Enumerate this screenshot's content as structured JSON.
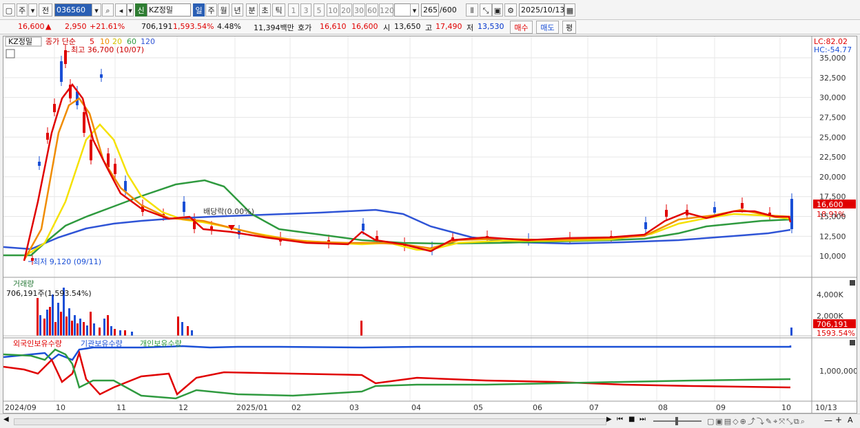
{
  "toolbar": {
    "market": "주",
    "period_prefix": "전",
    "code": "036560",
    "stock_name": "KZ정밀",
    "new_badge": "신",
    "periods": [
      "일",
      "주",
      "월",
      "년",
      "분",
      "초",
      "틱"
    ],
    "minute_options": [
      "1",
      "3",
      "5",
      "10",
      "20",
      "30",
      "60",
      "120"
    ],
    "count": "265",
    "count_total": "/600",
    "date": "2025/10/13"
  },
  "quote": {
    "price": "16,600",
    "change": "2,950",
    "change_pct": "+21.61%",
    "volume": "706,191",
    "volume_pct": "1,593.54%",
    "turnover": "4.48%",
    "amount": "11,394백만",
    "bid_label": "호가",
    "bid1": "16,610",
    "bid2": "16,600",
    "open_label": "시",
    "open": "13,650",
    "high_label": "고",
    "high": "17,490",
    "low_label": "저",
    "low": "13,530",
    "buy_label": "매수",
    "sell_label": "매도",
    "eval_label": "평"
  },
  "price_panel": {
    "name": "KZ정밀",
    "ma_label": "종가 단순",
    "ma_periods": [
      "5",
      "10",
      "20",
      "60",
      "120"
    ],
    "ma_colors": [
      "#e00000",
      "#f08c00",
      "#f5e100",
      "#2f9a3f",
      "#2f54d6"
    ],
    "high_note": "최고 36,700 (10/07)",
    "low_note": "최저 9,120 (09/11)",
    "dividend_note": "배당락(0.00%)",
    "lc": "LC:82.02",
    "hc": "HC:-54.77",
    "y_ticks": [
      "35,000",
      "32,500",
      "30,000",
      "27,500",
      "25,000",
      "22,500",
      "20,000",
      "17,500",
      "15,000",
      "12,500",
      "10,000"
    ],
    "y_values": [
      35000,
      32500,
      30000,
      27500,
      25000,
      22500,
      20000,
      17500,
      15000,
      12500,
      10000
    ],
    "current_tag": "16,600",
    "current_pct": "18.91%"
  },
  "volume_panel": {
    "name": "거래량",
    "note": "706,191주(1,593.54%)",
    "y_ticks": [
      "4,000K",
      "2,000K"
    ],
    "current_tag": "706,191",
    "current_pct": "1593.54%"
  },
  "holdings_panel": {
    "names": [
      "외국인보유수량",
      "기관보유수량",
      "개인보유수량"
    ],
    "y_tick": "1,000,000"
  },
  "x_axis": [
    "2024/09",
    "10",
    "11",
    "12",
    "2025/01",
    "02",
    "03",
    "04",
    "05",
    "06",
    "07",
    "08",
    "09",
    "10",
    "10/13"
  ],
  "colors": {
    "up": "#e00000",
    "down": "#1a4fd6",
    "accent": "#003c8f"
  }
}
